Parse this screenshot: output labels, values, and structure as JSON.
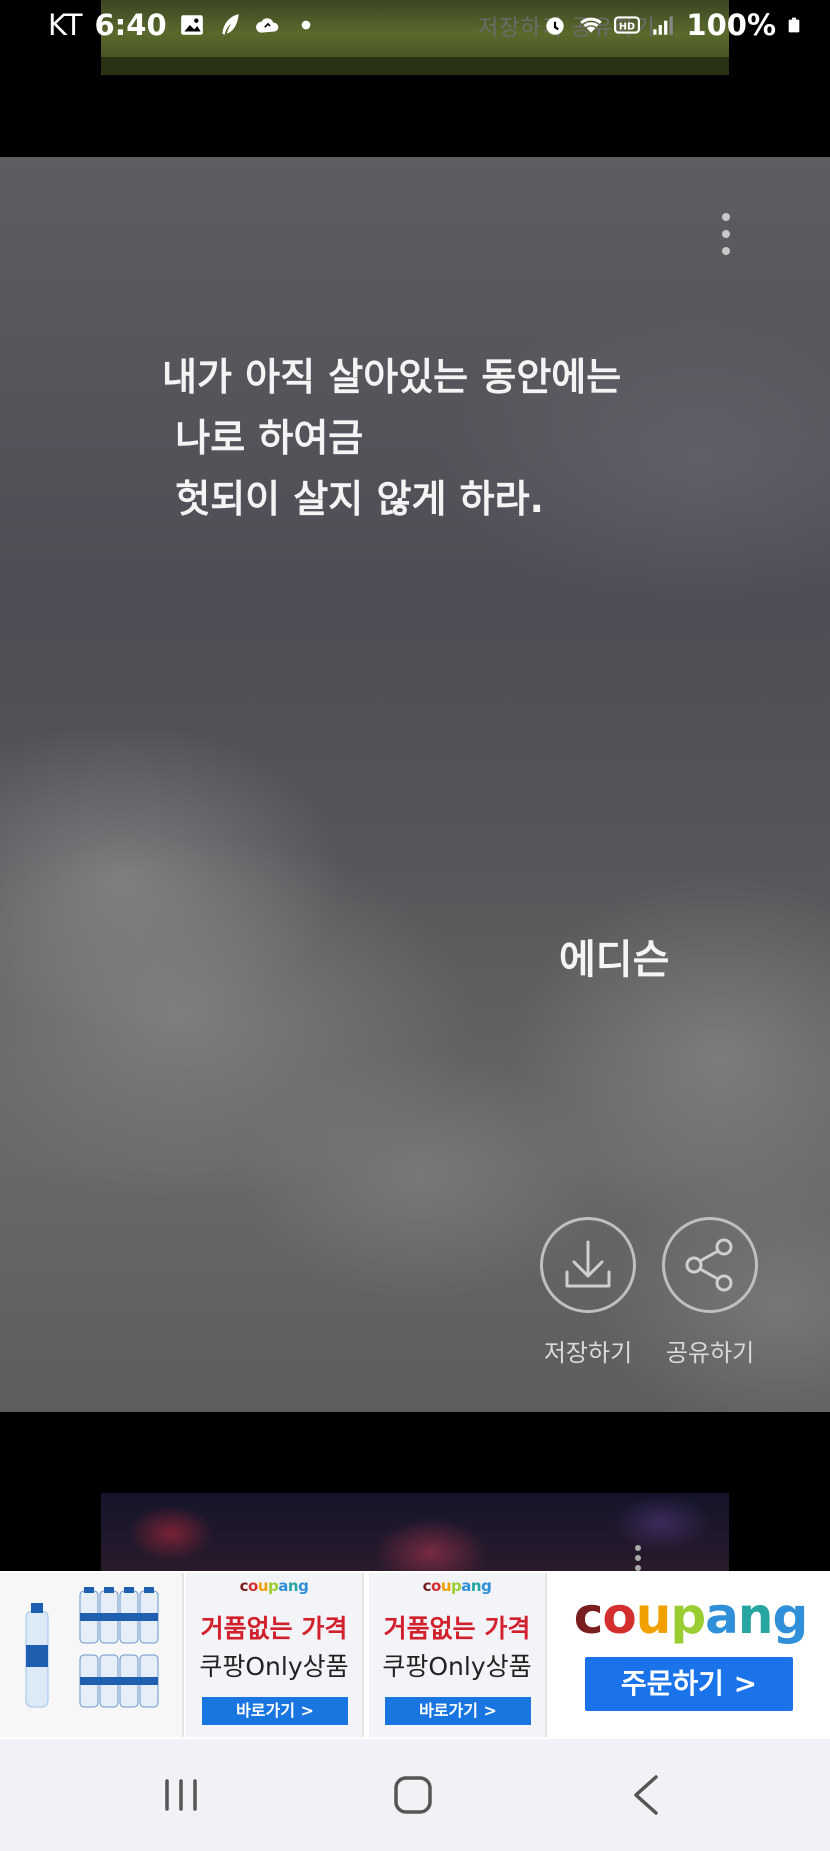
{
  "status_bar": {
    "carrier": "KT",
    "time": "6:40",
    "battery": "100%",
    "icons": [
      "image-icon",
      "feather-icon",
      "cloud-icon",
      "dot-icon",
      "alarm-icon",
      "wifi-icon",
      "hd-icon",
      "signal-icon",
      "battery-icon"
    ],
    "ghost_text": "저장하기 공유하기"
  },
  "quote_card": {
    "lines": [
      "내가 아직 살아있는 동안에는",
      " 나로 하여금",
      " 헛되이 살지 않게 하라."
    ],
    "author": "에디슨",
    "save_label": "저장하기",
    "share_label": "공유하기"
  },
  "ad": {
    "tile_a": {
      "brand": "coupang",
      "title": "거품없는 가격",
      "subtitle": "쿠팡Only상품",
      "button": "바로가기 >"
    },
    "tile_b": {
      "brand": "coupang",
      "title": "거품없는 가격",
      "subtitle": "쿠팡Only상품",
      "button": "바로가기 >"
    },
    "logo": "coupang",
    "order_button": "주문하기 >"
  },
  "nav": {
    "icons": [
      "recent-apps-icon",
      "home-icon",
      "back-icon"
    ]
  },
  "colors": {
    "ad_button": "#1a73e8",
    "ad_title": "#d2202c",
    "nav_bg": "#f1f2f6"
  }
}
